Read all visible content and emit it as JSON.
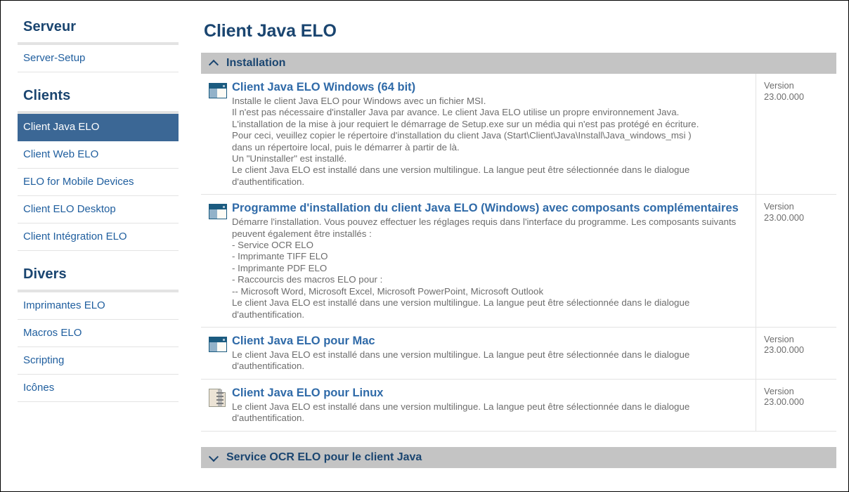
{
  "sidebar": {
    "groups": [
      {
        "heading": "Serveur",
        "items": [
          {
            "label": "Server-Setup",
            "active": false
          }
        ]
      },
      {
        "heading": "Clients",
        "items": [
          {
            "label": "Client Java ELO",
            "active": true
          },
          {
            "label": "Client Web ELO",
            "active": false
          },
          {
            "label": "ELO for Mobile Devices",
            "active": false
          },
          {
            "label": "Client ELO Desktop",
            "active": false
          },
          {
            "label": "Client Intégration ELO",
            "active": false
          }
        ]
      },
      {
        "heading": "Divers",
        "items": [
          {
            "label": "Imprimantes ELO",
            "active": false
          },
          {
            "label": "Macros ELO",
            "active": false
          },
          {
            "label": "Scripting",
            "active": false
          },
          {
            "label": "Icônes",
            "active": false
          }
        ]
      }
    ]
  },
  "main": {
    "page_title": "Client Java ELO",
    "sections": [
      {
        "title": "Installation",
        "expanded": true,
        "chevron": "chevron-up-icon",
        "rows": [
          {
            "icon": "window-application-icon",
            "title": "Client Java ELO Windows (64 bit)",
            "description": "Installe le client Java ELO pour Windows avec un fichier MSI.\nIl n'est pas nécessaire d'installer Java par avance. Le client Java ELO utilise un propre environnement Java.\nL'installation de la mise à jour requiert le démarrage de Setup.exe sur un média qui n'est pas protégé en écriture.\nPour ceci, veuillez copier le répertoire d'installation du client Java (Start\\Client\\Java\\Install\\Java_windows_msi )\ndans un répertoire local, puis le démarrer à partir de là.\nUn \"Uninstaller\" est installé.\nLe client Java ELO est installé dans une version multilingue. La langue peut être sélectionnée dans le dialogue d'authentification.",
            "version_label": "Version",
            "version_value": "23.00.000"
          },
          {
            "icon": "window-application-icon",
            "title": "Programme d'installation du client Java ELO (Windows) avec composants complémentaires",
            "description": "Démarre l'installation. Vous pouvez effectuer les réglages requis dans l'interface du programme. Les composants suivants peuvent également être installés :\n- Service OCR ELO\n- Imprimante TIFF ELO\n- Imprimante PDF ELO\n- Raccourcis des macros ELO pour :\n-- Microsoft Word, Microsoft Excel, Microsoft PowerPoint, Microsoft Outlook\nLe client Java ELO est installé dans une version multilingue. La langue peut être sélectionnée dans le dialogue d'authentification.",
            "version_label": "Version",
            "version_value": "23.00.000"
          },
          {
            "icon": "window-application-icon",
            "title": "Client Java ELO pour Mac",
            "description": "Le client Java ELO est installé dans une version multilingue. La langue peut être sélectionnée dans le dialogue d'authentification.",
            "version_label": "Version",
            "version_value": "23.00.000"
          },
          {
            "icon": "zip-archive-icon",
            "title": "Client Java ELO pour Linux",
            "description": "Le client Java ELO est installé dans une version multilingue. La langue peut être sélectionnée dans le dialogue d'authentification.",
            "version_label": "Version",
            "version_value": "23.00.000"
          }
        ]
      },
      {
        "title": "Service OCR ELO pour le client Java",
        "expanded": false,
        "chevron": "chevron-down-icon",
        "rows": []
      }
    ]
  },
  "colors": {
    "heading_blue": "#1a4570",
    "link_blue": "#1f5e9e",
    "title_blue": "#2f6aa8",
    "active_bg": "#3b6795",
    "section_bar": "#c4c4c4",
    "rule": "#e3e3e3",
    "body_text": "#6d6d6d"
  }
}
